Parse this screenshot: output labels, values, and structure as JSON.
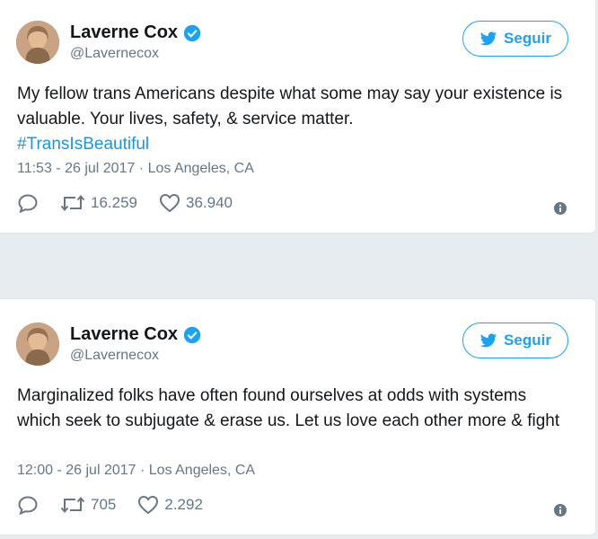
{
  "colors": {
    "accent": "#1da1f2",
    "link": "#1b95e0",
    "muted": "#657786",
    "text": "#14171a",
    "background": "#e6ecf0"
  },
  "tweets": [
    {
      "author_name": "Laverne Cox",
      "author_handle": "@Lavernecox",
      "follow_label": "Seguir",
      "text_main": "My fellow trans Americans despite what some may say your existence is valuable. Your lives, safety, & service matter.",
      "hashtag": "#TransIsBeautiful",
      "timestamp": "11:53 - 26 jul 2017 · Los Angeles, CA",
      "retweets": "16.259",
      "likes": "36.940"
    },
    {
      "author_name": "Laverne Cox",
      "author_handle": "@Lavernecox",
      "follow_label": "Seguir",
      "text_main": "Marginalized folks have often found ourselves at odds with systems which seek to subjugate & erase us. Let us love each other more & fight",
      "timestamp": "12:00 - 26 jul 2017 · Los Angeles, CA",
      "retweets": "705",
      "likes": "2.292"
    }
  ],
  "icons": [
    "verified-badge-icon",
    "twitter-bird-icon",
    "reply-icon",
    "retweet-icon",
    "like-icon",
    "info-icon"
  ]
}
